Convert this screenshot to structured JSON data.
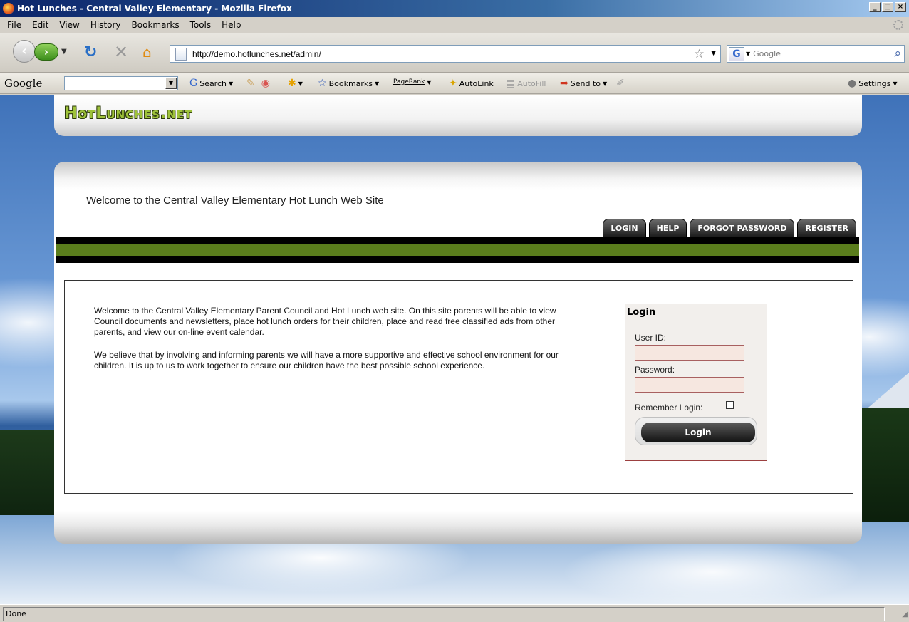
{
  "window": {
    "title": "Hot Lunches - Central Valley Elementary - Mozilla Firefox"
  },
  "menu": [
    "File",
    "Edit",
    "View",
    "History",
    "Bookmarks",
    "Tools",
    "Help"
  ],
  "nav": {
    "url": "http://demo.hotlunches.net/admin/",
    "search_placeholder": "Google",
    "search_engine_letter": "G"
  },
  "google_toolbar": {
    "logo": "Google",
    "search_label": "Search",
    "bookmarks_label": "Bookmarks",
    "pagerank_label": "PageRank",
    "autolink_label": "AutoLink",
    "autofill_label": "AutoFill",
    "sendto_label": "Send to",
    "settings_label": "Settings"
  },
  "site": {
    "logo": "HotLunches.net",
    "heading": "Welcome to the Central Valley Elementary Hot Lunch Web Site",
    "tabs": [
      "LOGIN",
      "HELP",
      "FORGOT PASSWORD",
      "REGISTER"
    ],
    "intro": [
      "Welcome to the Central Valley Elementary Parent Council and Hot Lunch web site. On this site parents will be able to view Council documents and newsletters, place hot lunch orders for their children, place and read free classified ads from other parents, and view our on-line event calendar.",
      "We believe that by involving and informing parents we will have a more supportive and effective school environment for our children. It is up to us to work together to ensure our children have the best possible school experience."
    ],
    "login": {
      "title": "Login",
      "user_label": "User ID:",
      "user_value": "",
      "password_label": "Password:",
      "password_value": "",
      "remember_label": "Remember Login:",
      "button_label": "Login"
    }
  },
  "status": {
    "text": "Done"
  }
}
